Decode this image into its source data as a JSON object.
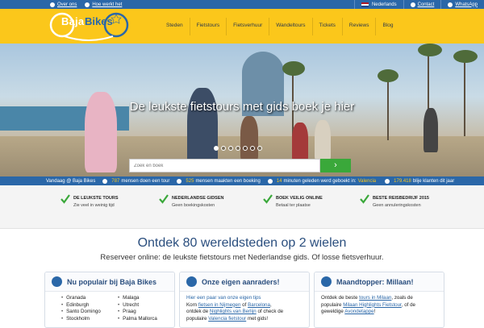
{
  "topbar": {
    "left_links": [
      "Over ons",
      "Hoe werkt het"
    ],
    "right_items": [
      "Nederlands",
      "Contact",
      "WhatsApp"
    ]
  },
  "logo": {
    "part1": "Baja",
    "part2": "Bikes"
  },
  "nav": [
    "Steden",
    "Fietstours",
    "Fietsverhuur",
    "Wandeltours",
    "Tickets",
    "Reviews",
    "Blog"
  ],
  "hero": {
    "headline": "De leukste fietstours met gids boek je hier",
    "slide_count": 7,
    "active_slide": 1,
    "search_placeholder": "Zoek en boek",
    "search_button": "›"
  },
  "stats": {
    "label": "Vandaag @ Baja Bikes",
    "items": [
      {
        "num": "787",
        "text": "mensen doen een tour"
      },
      {
        "num": "525",
        "text": "mensen maakten een boeking"
      },
      {
        "num": "14",
        "text": "minuten geleden werd geboekt in:",
        "extra": "Valencia"
      },
      {
        "num": "179.418",
        "text": "blije klanten dit jaar"
      }
    ]
  },
  "usps": [
    {
      "title": "DE LEUKSTE TOURS",
      "sub": "Zie veel in weinig tijd"
    },
    {
      "title": "NEDERLANDSE GIDSEN",
      "sub": "Geen boekingskosten"
    },
    {
      "title": "BOEK VEILIG ONLINE",
      "sub": "Betaal ter plaatse"
    },
    {
      "title": "BESTE REISBEDRIJF 2015",
      "sub": "Geen annuleringskosten"
    }
  ],
  "main": {
    "heading": "Ontdek 80 wereldsteden op 2 wielen",
    "subheading": "Reserveer online: de leukste fietstours met Nederlandse gids. Of losse fietsverhuur."
  },
  "cards": {
    "popular": {
      "title": "Nu populair bij Baja Bikes",
      "col1": [
        "Granada",
        "Edinburgh",
        "Santo Domingo",
        "Stockholm"
      ],
      "col2": [
        "Malaga",
        "Utrecht",
        "Praag",
        "Palma Mallorca"
      ]
    },
    "tips": {
      "title": "Onze eigen aanraders!",
      "line1": "Hier een paar van onze eigen tips",
      "l2a": "Korn",
      "l2b": "fietsen in Nijmegen",
      "l2c": "of",
      "l2d": "Barcelona",
      "l3a": "ontdek de",
      "l3b": "Nighlights van Berlijn",
      "l3c": "of check de",
      "l4a": "populaire",
      "l4b": "Valencia fietstour",
      "l4c": "met gids!"
    },
    "topper": {
      "title": "Maandtopper: Millaan!",
      "l1a": "Ontdek de beste",
      "l1b": "tours in Milaan",
      "l1c": ", zoals de",
      "l2a": "populaire",
      "l2b": "Milaan Highlights Fietstour",
      "l2c": ", of de",
      "l3a": "geweldige",
      "l3b": "Avondetappe",
      "l3c": "!"
    }
  }
}
